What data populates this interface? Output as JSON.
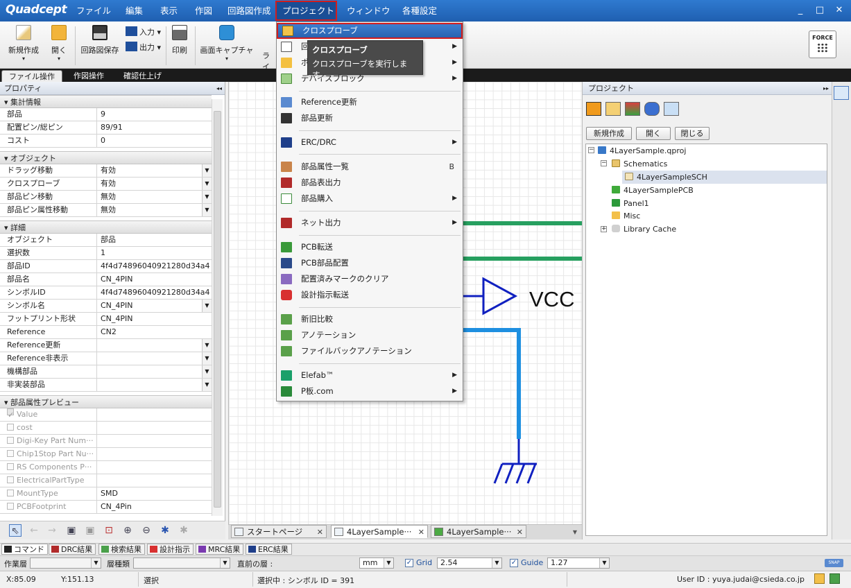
{
  "app": {
    "logo": "Quadcept"
  },
  "menubar": [
    {
      "label": "ファイル"
    },
    {
      "label": "編集"
    },
    {
      "label": "表示"
    },
    {
      "label": "作図"
    },
    {
      "label": "回路図作成"
    },
    {
      "label": "プロジェクト"
    },
    {
      "label": "ウィンドウ"
    },
    {
      "label": "各種設定"
    }
  ],
  "window_controls": {
    "minimize": "_",
    "maximize": "□",
    "close": "✕"
  },
  "ribbon": {
    "new": "新規作成",
    "open": "開く",
    "save": "回路図保存",
    "input": "入力",
    "output": "出力",
    "print": "印刷",
    "capture": "画面キャプチャ",
    "truncated": "ライ",
    "force": "FORCE"
  },
  "ribbon_tabs": [
    "ファイル操作",
    "作図操作",
    "確認仕上げ"
  ],
  "left_panel": {
    "title": "プロパティ",
    "collapse": "◂◂",
    "sections": {
      "summary": {
        "title": "集計情報",
        "rows": [
          {
            "k": "部品",
            "v": "9"
          },
          {
            "k": "配置ピン/総ピン",
            "v": "89/91"
          },
          {
            "k": "コスト",
            "v": "0"
          }
        ]
      },
      "object": {
        "title": "オブジェクト",
        "rows": [
          {
            "k": "ドラッグ移動",
            "v": "有効"
          },
          {
            "k": "クロスプローブ",
            "v": "有効"
          },
          {
            "k": "部品ピン移動",
            "v": "無効"
          },
          {
            "k": "部品ピン属性移動",
            "v": "無効"
          }
        ]
      },
      "detail": {
        "title": "詳細",
        "rows": [
          {
            "k": "オブジェクト",
            "v": "部品"
          },
          {
            "k": "選択数",
            "v": "1"
          },
          {
            "k": "部品ID",
            "v": "4f4d74896040921280d34a4"
          },
          {
            "k": "部品名",
            "v": "CN_4PIN"
          },
          {
            "k": "シンボルID",
            "v": "4f4d74896040921280d34a4"
          },
          {
            "k": "シンボル名",
            "v": "CN_4PIN"
          },
          {
            "k": "フットプリント形状",
            "v": "CN_4PIN"
          },
          {
            "k": "Reference",
            "v": "CN2"
          },
          {
            "k": "Reference更新",
            "v": ""
          },
          {
            "k": "Reference非表示",
            "v": ""
          },
          {
            "k": "機構部品",
            "v": ""
          },
          {
            "k": "非実装部品",
            "v": ""
          }
        ]
      },
      "preview": {
        "title": "部品属性プレビュー",
        "rows": [
          {
            "k": "Value",
            "v": ""
          },
          {
            "k": "cost",
            "v": ""
          },
          {
            "k": "Digi-Key Part Num···",
            "v": ""
          },
          {
            "k": "Chip1Stop Part Nu···",
            "v": ""
          },
          {
            "k": "RS Components P···",
            "v": ""
          },
          {
            "k": "ElectricalPartType",
            "v": ""
          },
          {
            "k": "MountType",
            "v": "SMD"
          },
          {
            "k": "PCBFootprint",
            "v": "CN_4Pin"
          }
        ]
      }
    }
  },
  "canvas": {
    "net_label": "VCC"
  },
  "doc_tabs": [
    {
      "label": "スタートページ"
    },
    {
      "label": "4LayerSample···"
    },
    {
      "label": "4LayerSample···"
    }
  ],
  "doc_tab_close": "✕",
  "right_panel": {
    "title": "プロジェクト",
    "collapse": "▸▸",
    "buttons": {
      "new": "新規作成",
      "open": "開く",
      "close": "閉じる"
    },
    "tree": [
      {
        "label": "4LayerSample.qproj"
      },
      {
        "label": "Schematics"
      },
      {
        "label": "4LayerSampleSCH"
      },
      {
        "label": "4LayerSamplePCB"
      },
      {
        "label": "Panel1"
      },
      {
        "label": "Misc"
      },
      {
        "label": "Library Cache"
      }
    ]
  },
  "dropdown": {
    "items": [
      {
        "label": "クロスプローブ"
      },
      {
        "label": "回"
      },
      {
        "label": "ポ"
      },
      {
        "label": "デバイスブロック"
      },
      {
        "label": "Reference更新"
      },
      {
        "label": "部品更新"
      },
      {
        "label": "ERC/DRC"
      },
      {
        "label": "部品属性一覧",
        "shortcut": "B"
      },
      {
        "label": "部品表出力"
      },
      {
        "label": "部品購入"
      },
      {
        "label": "ネット出力"
      },
      {
        "label": "PCB転送"
      },
      {
        "label": "PCB部品配置"
      },
      {
        "label": "配置済みマークのクリア"
      },
      {
        "label": "設計指示転送"
      },
      {
        "label": "新旧比較"
      },
      {
        "label": "アノテーション"
      },
      {
        "label": "ファイルバックアノテーション"
      },
      {
        "label": "Elefab™"
      },
      {
        "label": "P板.com"
      }
    ],
    "tooltip": {
      "title": "クロスプローブ",
      "body": "クロスプローブを実行します。"
    }
  },
  "output_tabs": [
    {
      "label": "コマンド"
    },
    {
      "label": "DRC結果"
    },
    {
      "label": "検索結果"
    },
    {
      "label": "設計指示"
    },
    {
      "label": "MRC結果"
    },
    {
      "label": "ERC結果"
    }
  ],
  "layer_bar": {
    "work_layer": "作業層",
    "layer_type": "層種類",
    "prev_layer": "直前の層 :",
    "unit": "mm",
    "grid_label": "Grid",
    "grid_value": "2.54",
    "guide_label": "Guide",
    "guide_value": "1.27",
    "snap": "SNAP"
  },
  "status": {
    "x": "X:85.09",
    "y": "Y:151.13",
    "mode": "選択",
    "selection": "選択中 : シンボル ID = 391",
    "user": "User ID : yuya.judai@csieda.co.jp"
  },
  "colors": {
    "menubar": "#2769c0",
    "highlight": "#d21c1c",
    "wire_green": "#27a060",
    "wire_blue": "#1020c0",
    "wire_lightblue": "#1e8fe0"
  }
}
